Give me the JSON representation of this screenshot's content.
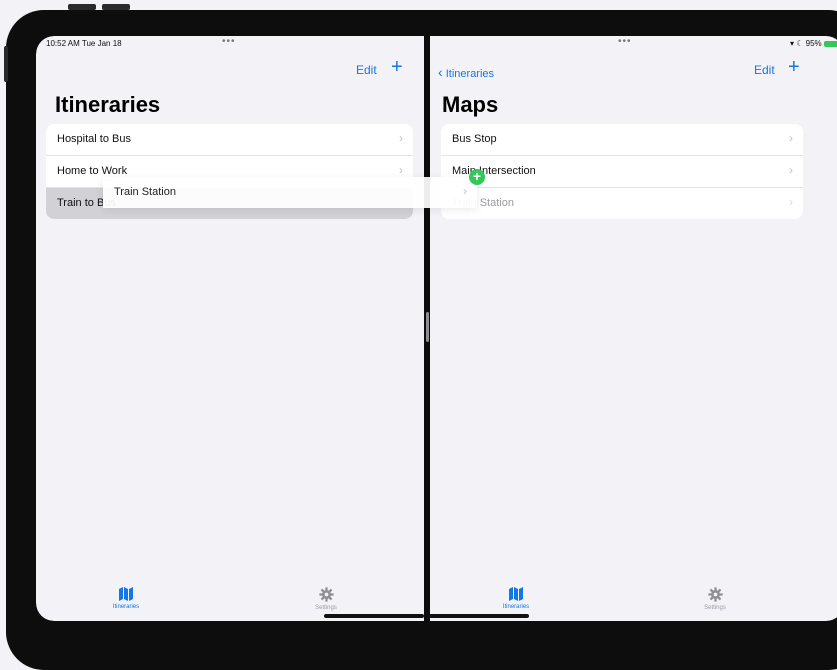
{
  "status_bar": {
    "time": "10:52 AM  Tue Jan 18",
    "multitask_dots": "•••",
    "battery": "95%"
  },
  "left_pane": {
    "nav": {
      "edit_label": "Edit",
      "add_label": "+"
    },
    "title": "Itineraries",
    "items": [
      {
        "label": "Hospital to Bus"
      },
      {
        "label": "Home to Work"
      },
      {
        "label": "Train to Bus"
      }
    ],
    "chevron": "›"
  },
  "right_pane": {
    "nav": {
      "back_label": "Itineraries",
      "edit_label": "Edit",
      "add_label": "+"
    },
    "title": "Maps",
    "items": [
      {
        "label": "Bus Stop"
      },
      {
        "label": "Main Intersection"
      },
      {
        "label": "Train Station"
      }
    ],
    "chevron": "›"
  },
  "drag_preview": {
    "label": "Train Station",
    "badge": "+"
  },
  "tab_bar": {
    "items": [
      {
        "label": "Itineraries",
        "icon": "map-icon",
        "active": true
      },
      {
        "label": "Settings",
        "icon": "gear-icon",
        "active": false
      }
    ]
  },
  "colors": {
    "accent": "#1577e6",
    "add_badge": "#34c759"
  }
}
